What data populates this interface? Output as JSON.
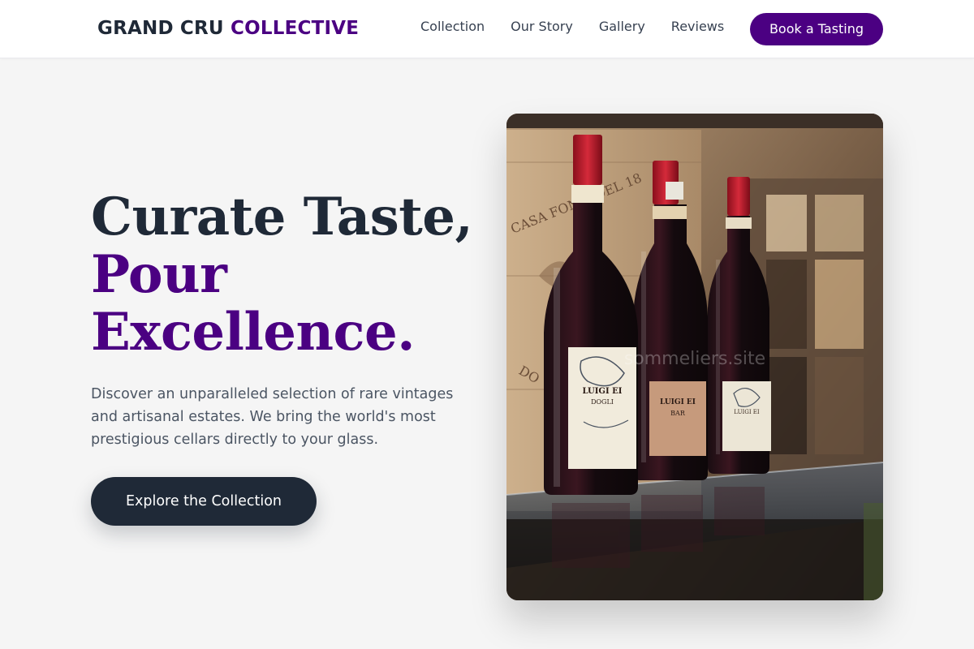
{
  "brand": {
    "name_part1": "GRAND CRU",
    "name_part2": "COLLECTIVE"
  },
  "nav": {
    "links": [
      "Collection",
      "Our Story",
      "Gallery",
      "Reviews"
    ],
    "cta_label": "Book a Tasting"
  },
  "hero": {
    "title_line1": "Curate Taste,",
    "title_line2": "Pour",
    "title_line3": "Excellence.",
    "description": "Discover an unparalleled selection of rare vintages and artisanal estates. We bring the world's most prestigious cellars directly to your glass.",
    "cta_label": "Explore the Collection"
  },
  "image": {
    "watermark": "sommeliers.site",
    "crate_text": "CASA FONTI DEL ...",
    "bottle_labels": [
      "LUIGI EI...",
      "LUIGI EI...",
      "LUIGI EI..."
    ]
  },
  "colors": {
    "accent": "#4b0082",
    "dark": "#1f2937",
    "background": "#f5f5f5"
  }
}
